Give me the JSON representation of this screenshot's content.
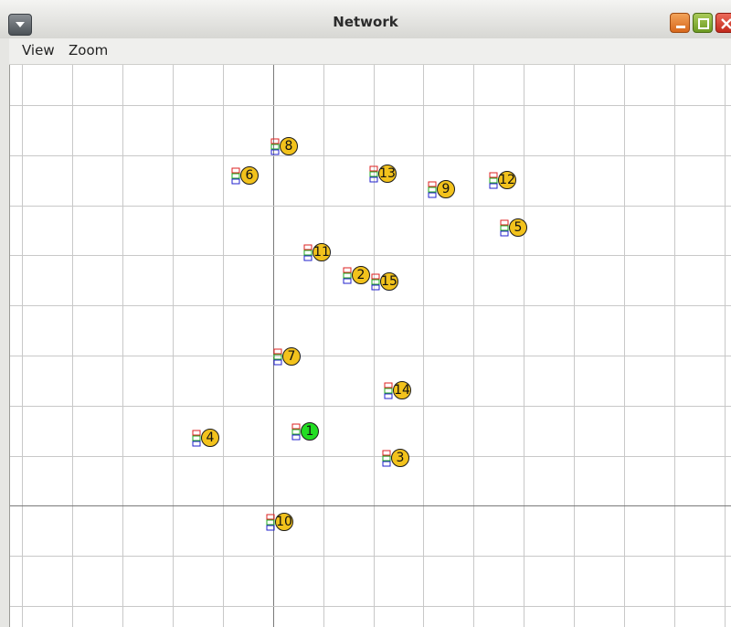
{
  "window": {
    "title": "Network"
  },
  "menu": [
    {
      "label": "View"
    },
    {
      "label": "Zoom"
    }
  ],
  "nodes": [
    {
      "id": "8"
    },
    {
      "id": "6"
    },
    {
      "id": "13"
    },
    {
      "id": "9"
    },
    {
      "id": "12"
    },
    {
      "id": "5"
    },
    {
      "id": "11"
    },
    {
      "id": "2"
    },
    {
      "id": "15"
    },
    {
      "id": "7"
    },
    {
      "id": "14"
    },
    {
      "id": "1",
      "selected": true
    },
    {
      "id": "4"
    },
    {
      "id": "3"
    },
    {
      "id": "10"
    }
  ],
  "colors": {
    "node_fill": "#f2c21c",
    "node_selected_fill": "#22dd22",
    "grid_line": "#c8c8c8",
    "axis_line": "#7a7a7a"
  }
}
